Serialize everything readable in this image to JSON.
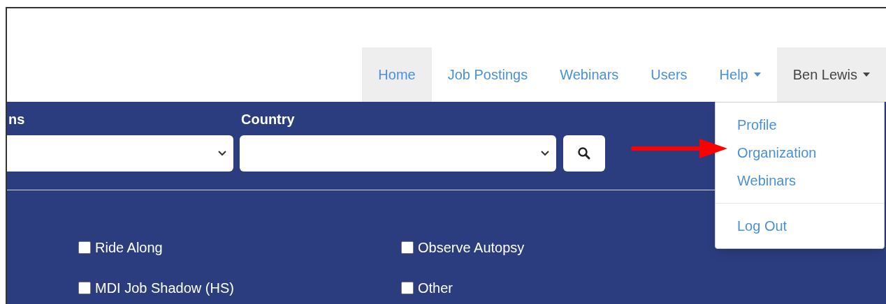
{
  "nav": {
    "items": [
      {
        "label": "Home",
        "kind": "link",
        "selected": true
      },
      {
        "label": "Job Postings",
        "kind": "link",
        "selected": false
      },
      {
        "label": "Webinars",
        "kind": "link",
        "selected": false
      },
      {
        "label": "Users",
        "kind": "link",
        "selected": false
      },
      {
        "label": "Help",
        "kind": "dropdown",
        "expanded": false
      },
      {
        "label": "Ben Lewis",
        "kind": "dropdown",
        "expanded": true,
        "menu": [
          {
            "label": "Profile",
            "kind": "item"
          },
          {
            "label": "Organization",
            "kind": "item"
          },
          {
            "label": "Webinars",
            "kind": "item"
          },
          {
            "kind": "divider"
          },
          {
            "label": "Log Out",
            "kind": "item"
          }
        ]
      }
    ]
  },
  "filters": [
    {
      "label": "ns"
    },
    {
      "label": "Country"
    }
  ],
  "options": [
    {
      "label": "Ride Along",
      "checked": false
    },
    {
      "label": "Observe Autopsy",
      "checked": false
    },
    {
      "label": "MDI Job Shadow (HS)",
      "checked": false
    },
    {
      "label": "Other",
      "checked": false
    }
  ]
}
